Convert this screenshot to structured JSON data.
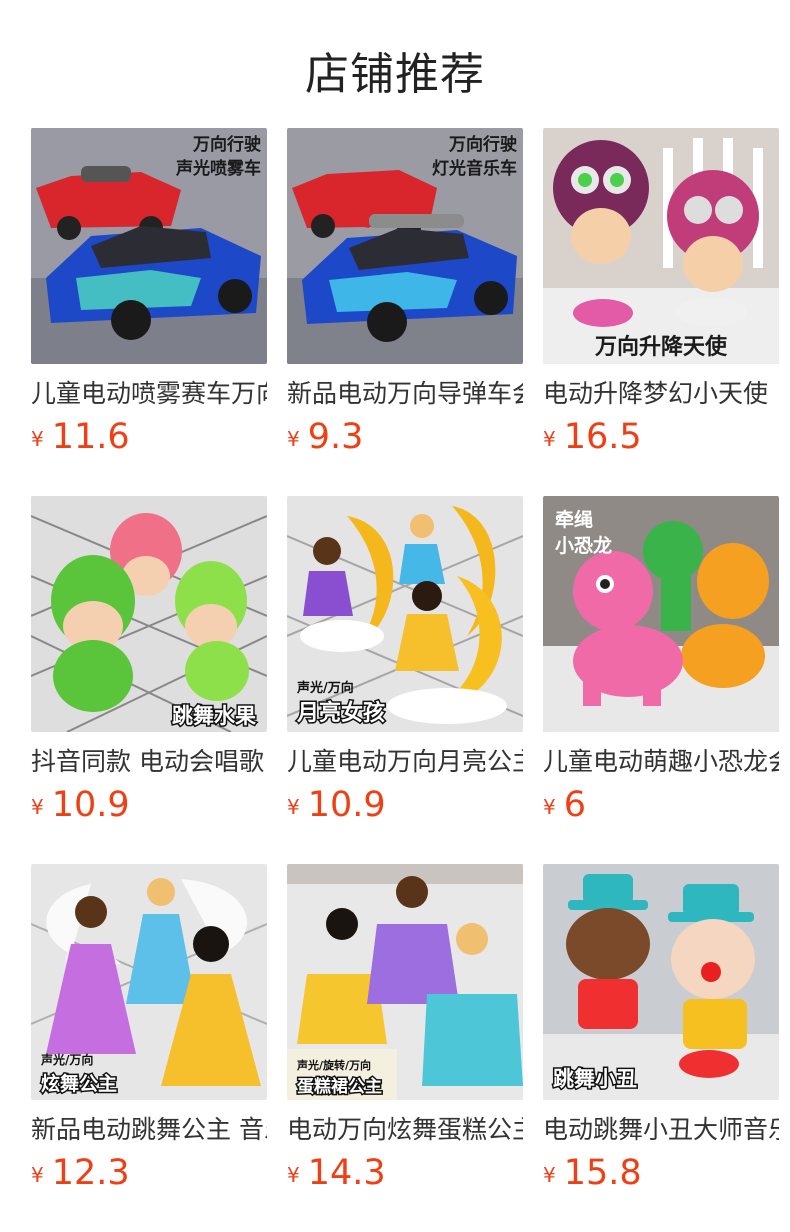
{
  "page": {
    "title": "店铺推荐"
  },
  "currency_symbol": "¥",
  "accent_color": "#ef3f14",
  "products": [
    {
      "name": "儿童电动喷雾赛车万向",
      "price": "11.6",
      "badge": [
        "万向行驶",
        "声光喷雾车"
      ],
      "image_icon": "spray-race-car-image"
    },
    {
      "name": "新品电动万向导弹车会",
      "price": "9.3",
      "badge": [
        "万向行驶",
        "灯光音乐车"
      ],
      "image_icon": "missile-car-image"
    },
    {
      "name": "电动升降梦幻小天使",
      "price": "16.5",
      "badge": [
        "万向升降天使"
      ],
      "image_icon": "angel-doll-image"
    },
    {
      "name": "抖音同款 电动会唱歌",
      "price": "10.9",
      "badge": [
        "跳舞水果"
      ],
      "image_icon": "fruit-doll-image"
    },
    {
      "name": "儿童电动万向月亮公主",
      "price": "10.9",
      "badge": [
        "声光/万向",
        "月亮女孩"
      ],
      "image_icon": "moon-girl-image"
    },
    {
      "name": "儿童电动萌趣小恐龙会",
      "price": "6",
      "badge": [
        "牵绳",
        "小恐龙"
      ],
      "image_icon": "dinosaur-toy-image"
    },
    {
      "name": "新品电动跳舞公主 音乐",
      "price": "12.3",
      "badge": [
        "声光/万向",
        "炫舞公主"
      ],
      "image_icon": "dancing-princess-image"
    },
    {
      "name": "电动万向炫舞蛋糕公主",
      "price": "14.3",
      "badge": [
        "声光/旋转/万向",
        "蛋糕裙公主"
      ],
      "image_icon": "cake-princess-image"
    },
    {
      "name": "电动跳舞小丑大师音乐",
      "price": "15.8",
      "badge": [
        "跳舞小丑"
      ],
      "image_icon": "dancing-clown-image"
    }
  ]
}
